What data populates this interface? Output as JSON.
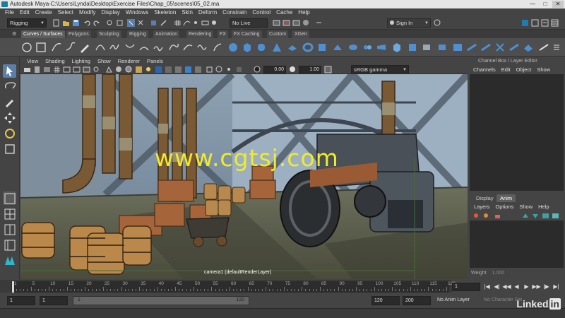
{
  "window": {
    "title": "Autodesk Maya-C:\\Users\\Lynda\\Desktop\\Exercise Files\\Chap_05\\scenes\\05_02.ma",
    "controls": [
      "—",
      "□",
      "✕"
    ]
  },
  "menubar": [
    "File",
    "Edit",
    "Create",
    "Select",
    "Modify",
    "Display",
    "Windows",
    "Skeleton",
    "Skin",
    "Deform",
    "Constrain",
    "Control",
    "Cache",
    "Help"
  ],
  "status_line": {
    "menu_set": "Rigging",
    "live_surface": "No Live Surface",
    "sign_in": "Sign In"
  },
  "shelf_tabs": [
    "Curves / Surfaces",
    "Polygons",
    "Sculpting",
    "Rigging",
    "Animation",
    "Rendering",
    "FX",
    "FX Caching",
    "Custom",
    "XGen"
  ],
  "active_shelf_tab": "Curves / Surfaces",
  "viewport": {
    "menu": [
      "View",
      "Shading",
      "Lighting",
      "Show",
      "Renderer",
      "Panels"
    ],
    "exposure": "0.00",
    "gamma": "1.00",
    "color_space": "sRGB gamma",
    "camera_label": "camera1 (defaultRenderLayer)",
    "watermark": "www.cgtsj.com"
  },
  "channel_box": {
    "header": "Channel Box / Layer Editor",
    "menu": [
      "Channels",
      "Edit",
      "Object",
      "Show"
    ]
  },
  "layer_editor": {
    "tabs": [
      "Display",
      "Anim"
    ],
    "active_tab": "Anim",
    "menu": [
      "Layers",
      "Options",
      "Show",
      "Help"
    ],
    "weight_label": "Weight",
    "weight_value": "1.000"
  },
  "timeline": {
    "ticks": [
      "1",
      "5",
      "10",
      "15",
      "20",
      "25",
      "30",
      "35",
      "40",
      "45",
      "50",
      "55",
      "60",
      "65",
      "70",
      "75",
      "80",
      "85",
      "90",
      "95",
      "100",
      "105",
      "110",
      "115",
      "120"
    ],
    "current_frame": "1",
    "playback_buttons": [
      "|◀",
      "◀|",
      "◀◀",
      "◀",
      "▶",
      "▶▶",
      "|▶",
      "▶|"
    ]
  },
  "range": {
    "start": "1",
    "playback_start": "1",
    "slider_start": "1",
    "slider_end": "120",
    "playback_end": "120",
    "end": "200",
    "anim_layer": "No Anim Layer",
    "character_set": "No Character Set"
  },
  "branding": {
    "linkedin_word": "Linked",
    "linkedin_badge": "in"
  }
}
